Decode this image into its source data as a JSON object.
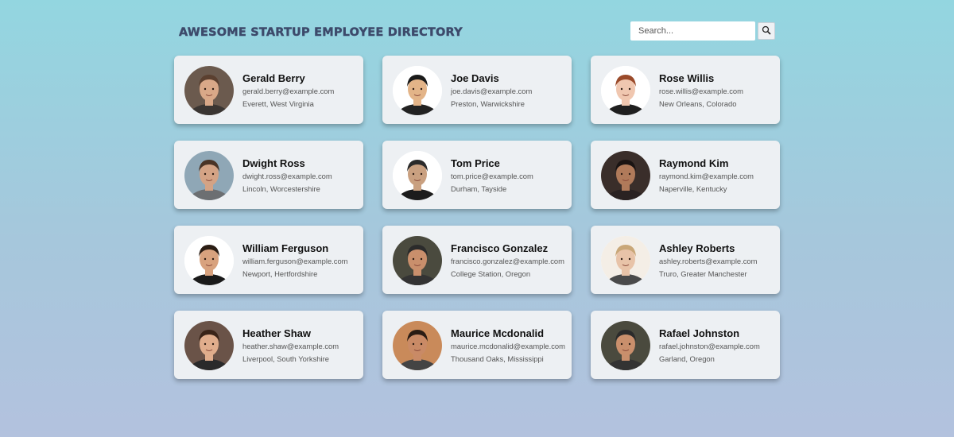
{
  "header": {
    "title": "Awesome Startup Employee Directory",
    "search_placeholder": "Search...",
    "search_button_icon": "magnifier-icon"
  },
  "employees": [
    {
      "name": "Gerald Berry",
      "email": "gerald.berry@example.com",
      "location": "Everett, West Virginia",
      "photo": {
        "bg": "#6b5a4e",
        "skin": "#d9a888",
        "hair": "#5b4030",
        "shirt": "#3a3532"
      }
    },
    {
      "name": "Joe Davis",
      "email": "joe.davis@example.com",
      "location": "Preston, Warwickshire",
      "photo": {
        "bg": "#ffffff",
        "skin": "#e3b488",
        "hair": "#1a1a1a",
        "shirt": "#222222"
      }
    },
    {
      "name": "Rose Willis",
      "email": "rose.willis@example.com",
      "location": "New Orleans, Colorado",
      "photo": {
        "bg": "#ffffff",
        "skin": "#f0c7b0",
        "hair": "#9a4a2a",
        "shirt": "#1f1f1f"
      }
    },
    {
      "name": "Dwight Ross",
      "email": "dwight.ross@example.com",
      "location": "Lincoln, Worcestershire",
      "photo": {
        "bg": "#8fa7b6",
        "skin": "#d4a385",
        "hair": "#4a3426",
        "shirt": "#6c6f72"
      }
    },
    {
      "name": "Tom Price",
      "email": "tom.price@example.com",
      "location": "Durham, Tayside",
      "photo": {
        "bg": "#ffffff",
        "skin": "#c9a080",
        "hair": "#2a2a2a",
        "shirt": "#1c1c1c"
      }
    },
    {
      "name": "Raymond Kim",
      "email": "raymond.kim@example.com",
      "location": "Naperville, Kentucky",
      "photo": {
        "bg": "#3a2e2a",
        "skin": "#b07a5a",
        "hair": "#1a1413",
        "shirt": "#2a2222"
      }
    },
    {
      "name": "William Ferguson",
      "email": "william.ferguson@example.com",
      "location": "Newport, Hertfordshire",
      "photo": {
        "bg": "#ffffff",
        "skin": "#d8a27e",
        "hair": "#2b1d14",
        "shirt": "#1a1a1a"
      }
    },
    {
      "name": "Francisco Gonzalez",
      "email": "francisco.gonzalez@example.com",
      "location": "College Station, Oregon",
      "photo": {
        "bg": "#4a4a3e",
        "skin": "#c98f6c",
        "hair": "#2b2b2b",
        "shirt": "#333333"
      }
    },
    {
      "name": "Ashley Roberts",
      "email": "ashley.roberts@example.com",
      "location": "Truro, Greater Manchester",
      "photo": {
        "bg": "#f4eee6",
        "skin": "#e8c3a8",
        "hair": "#c9a778",
        "shirt": "#4a4a4a"
      }
    },
    {
      "name": "Heather Shaw",
      "email": "heather.shaw@example.com",
      "location": "Liverpool, South Yorkshire",
      "photo": {
        "bg": "#6a5348",
        "skin": "#e0ad8c",
        "hair": "#3a2418",
        "shirt": "#2a2a2a"
      }
    },
    {
      "name": "Maurice Mcdonalid",
      "email": "maurice.mcdonalid@example.com",
      "location": "Thousand Oaks, Mississippi",
      "photo": {
        "bg": "#c98a5a",
        "skin": "#c98a66",
        "hair": "#2a1c14",
        "shirt": "#444444"
      }
    },
    {
      "name": "Rafael Johnston",
      "email": "rafael.johnston@example.com",
      "location": "Garland, Oregon",
      "photo": {
        "bg": "#4a4a3e",
        "skin": "#c98f6c",
        "hair": "#2b2b2b",
        "shirt": "#333333"
      }
    }
  ]
}
